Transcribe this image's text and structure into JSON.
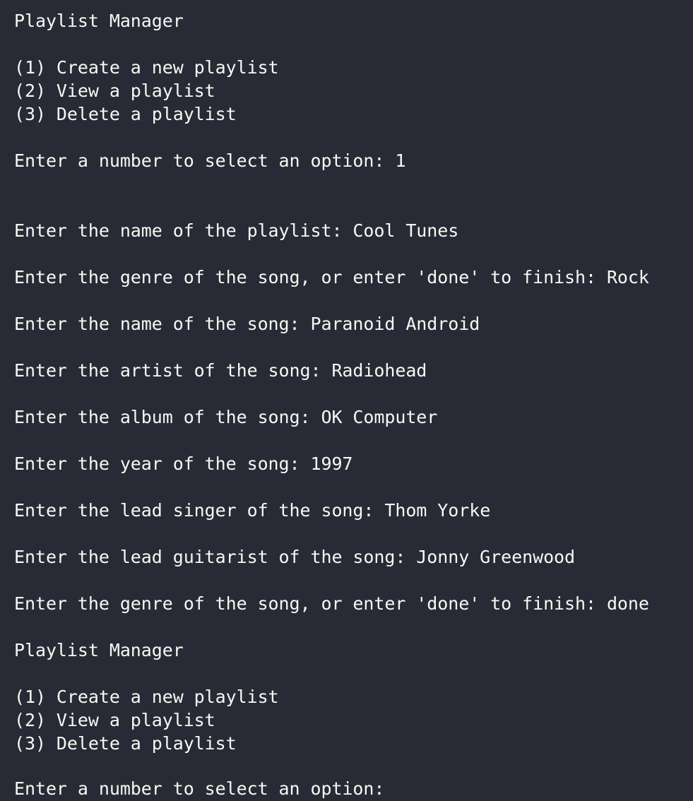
{
  "terminal": {
    "session": {
      "menu1": {
        "title": "Playlist Manager",
        "options": [
          "(1) Create a new playlist",
          "(2) View a playlist",
          "(3) Delete a playlist"
        ],
        "prompt": "Enter a number to select an option: ",
        "input": "1"
      },
      "create": {
        "playlist_name": {
          "prompt": "Enter the name of the playlist: ",
          "input": "Cool Tunes"
        },
        "genre": {
          "prompt": "Enter the genre of the song, or enter 'done' to finish: ",
          "input": "Rock"
        },
        "song_name": {
          "prompt": "Enter the name of the song: ",
          "input": "Paranoid Android"
        },
        "artist": {
          "prompt": "Enter the artist of the song: ",
          "input": "Radiohead"
        },
        "album": {
          "prompt": "Enter the album of the song: ",
          "input": "OK Computer"
        },
        "year": {
          "prompt": "Enter the year of the song: ",
          "input": "1997"
        },
        "lead_singer": {
          "prompt": "Enter the lead singer of the song: ",
          "input": "Thom Yorke"
        },
        "lead_guitarist": {
          "prompt": "Enter the lead guitarist of the song: ",
          "input": "Jonny Greenwood"
        },
        "genre_done": {
          "prompt": "Enter the genre of the song, or enter 'done' to finish: ",
          "input": "done"
        }
      },
      "menu2": {
        "title": "Playlist Manager",
        "options": [
          "(1) Create a new playlist",
          "(2) View a playlist",
          "(3) Delete a playlist"
        ],
        "prompt": "Enter a number to select an option:",
        "input": ""
      }
    },
    "colors": {
      "background": "#282a36",
      "foreground": "#f8f8f2"
    }
  }
}
